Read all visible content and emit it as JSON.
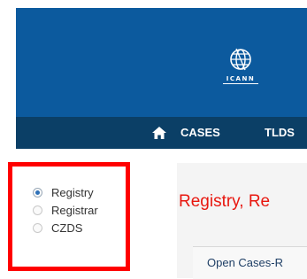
{
  "header": {
    "logo_text": "ICANN",
    "brand_color": "#0c5a9e"
  },
  "nav": {
    "home_icon": "home-icon",
    "items": [
      "CASES",
      "TLDS"
    ]
  },
  "radio_group": {
    "options": [
      {
        "label": "Registry",
        "checked": true
      },
      {
        "label": "Registrar",
        "checked": false
      },
      {
        "label": "CZDS",
        "checked": false
      }
    ]
  },
  "heading": "Registry, Re",
  "cases_panel": {
    "title": "Open Cases-R"
  },
  "colors": {
    "nav_bar": "#0b3f66",
    "highlight_border": "#ff0000",
    "heading_text": "#e8170f"
  }
}
